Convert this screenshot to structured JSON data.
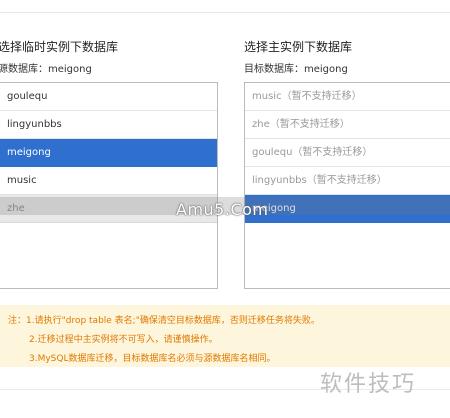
{
  "source": {
    "title": "选择临时实例下数据库",
    "subtitle": "源数据库：meigong",
    "items": [
      {
        "label": "goulequ",
        "state": "normal"
      },
      {
        "label": "lingyunbbs",
        "state": "normal"
      },
      {
        "label": "meigong",
        "state": "selected"
      },
      {
        "label": "music",
        "state": "normal"
      },
      {
        "label": "zhe",
        "state": "faded"
      }
    ]
  },
  "target": {
    "title": "选择主实例下数据库",
    "subtitle": "目标数据库：meigong",
    "items": [
      {
        "label": "music（暂不支持迁移）",
        "state": "disabled"
      },
      {
        "label": "zhe（暂不支持迁移）",
        "state": "disabled"
      },
      {
        "label": "goulequ（暂不支持迁移）",
        "state": "disabled"
      },
      {
        "label": "lingyunbbs（暂不支持迁移）",
        "state": "disabled"
      },
      {
        "label": "meigong",
        "state": "selected"
      }
    ]
  },
  "notes": {
    "line1": "注：1.请执行\"drop table 表名;\"确保清空目标数据库，否则迁移任务将失败。",
    "line2": "2.迁移过程中主实例将不可写入，请谨慎操作。",
    "line3": "3.MySQL数据库迁移，目标数据库名必须与源数据库名相同。"
  },
  "watermark": "Amu5.Com",
  "corner_watermark": "软件技巧",
  "colors": {
    "selected": "#2f6fce",
    "note_text": "#e27a00",
    "note_bg": "#fdf5dc"
  }
}
